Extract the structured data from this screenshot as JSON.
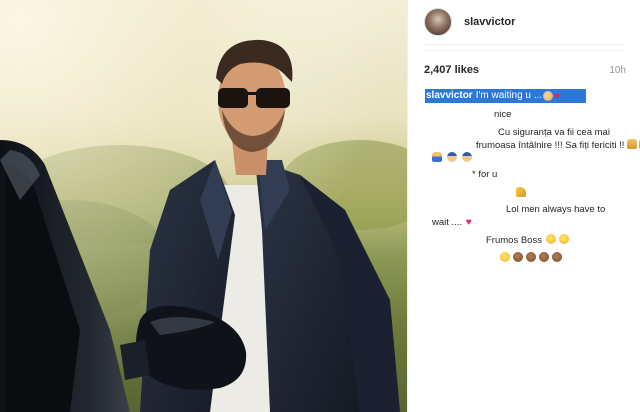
{
  "post": {
    "username": "slavvictor",
    "likes": "2,407 likes",
    "time": "10h",
    "caption_user": "slavvictor",
    "caption_text": "I'm waiting u ...",
    "icons": {
      "avatar": "profile-avatar",
      "caption_emoji": [
        "man-face-emoji",
        "red-heart-emoji"
      ]
    }
  },
  "comments": {
    "c1": "nice",
    "c2_line1": "Cu siguranța va fii cea mai",
    "c2_line2": "frumoasa întâlnire !!! Sa fiți fericiti !!",
    "c2_emojis": [
      "folded-hands-emoji",
      "folded-hands-emoji",
      "folded-hands-emoji",
      "police-face-emoji",
      "police-face-emoji"
    ],
    "c3": "* for u",
    "c4_emoji": "thumbs-up-emoji",
    "c5_line1": "Lol men always have to",
    "c5_line2": "wait ....",
    "c5_emoji": "red-heart-emoji",
    "c6": "Frumos Boss",
    "c6_emojis": [
      "smiling-face-emoji",
      "winking-face-emoji"
    ],
    "c7_emojis": [
      "tongue-face-emoji",
      "monkey-face-emoji",
      "man-face-emoji",
      "woman-face-emoji",
      "family-face-emoji"
    ]
  },
  "colors": {
    "highlight": "#2b78d9",
    "heart": "#e0245e",
    "text": "#262626",
    "muted": "#999999"
  }
}
